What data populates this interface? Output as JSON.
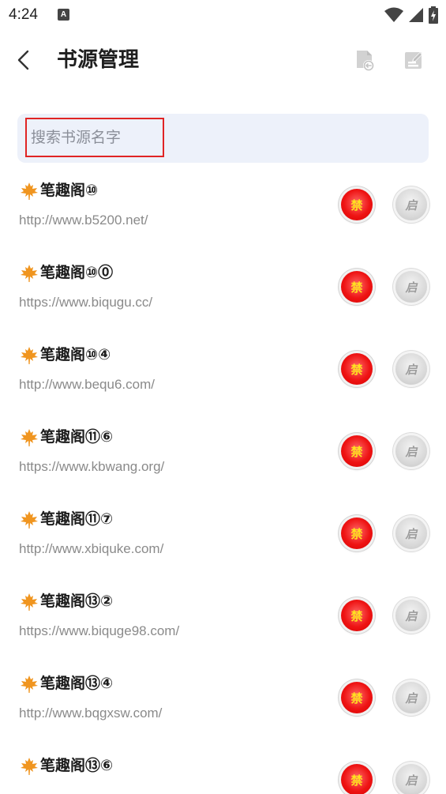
{
  "status": {
    "time": "4:24",
    "notification_letter": "A"
  },
  "header": {
    "title": "书源管理"
  },
  "search": {
    "placeholder": "搜索书源名字",
    "value": ""
  },
  "buttons": {
    "disable_label": "禁",
    "enable_label": "启"
  },
  "colors": {
    "accent_red": "#e02424",
    "search_bg": "#edf1fa",
    "url_gray": "#8a8a8a",
    "leaf_orange": "#f0951f"
  },
  "sources": [
    {
      "name": "笔趣阁⑩",
      "url": "http://www.b5200.net/"
    },
    {
      "name": "笔趣阁⑩⓪",
      "url": "https://www.biqugu.cc/"
    },
    {
      "name": "笔趣阁⑩④",
      "url": "http://www.bequ6.com/"
    },
    {
      "name": "笔趣阁⑪⑥",
      "url": "https://www.kbwang.org/"
    },
    {
      "name": "笔趣阁⑪⑦",
      "url": "http://www.xbiquke.com/"
    },
    {
      "name": "笔趣阁⑬②",
      "url": "https://www.biquge98.com/"
    },
    {
      "name": "笔趣阁⑬④",
      "url": "http://www.bqgxsw.com/"
    },
    {
      "name": "笔趣阁⑬⑥",
      "url": ""
    }
  ]
}
